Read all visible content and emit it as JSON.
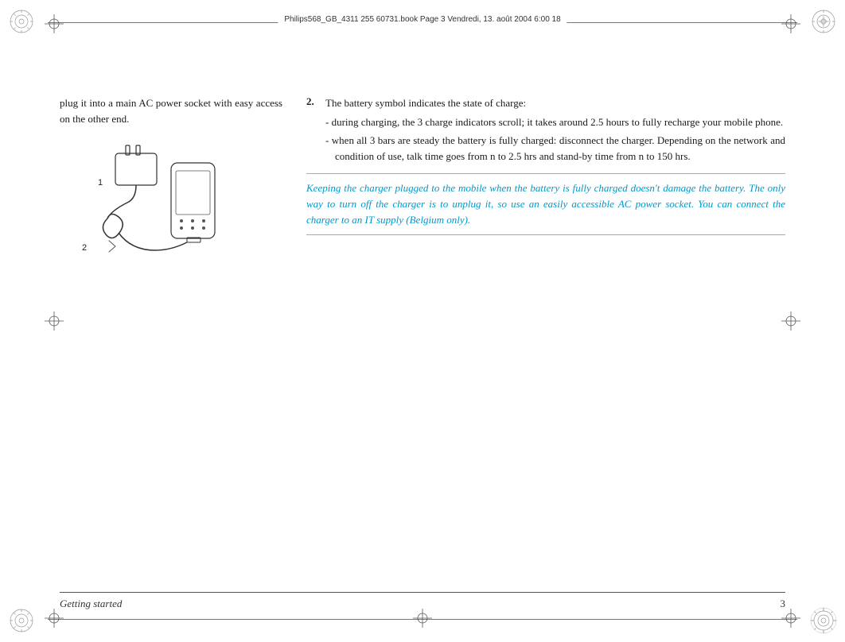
{
  "header": {
    "text": "Philips568_GB_4311 255 60731.book  Page 3  Vendredi, 13. août 2004  6:00 18"
  },
  "left_column": {
    "paragraph": "plug it into a main AC power socket with easy access on the other end."
  },
  "right_column": {
    "point_number": "2.",
    "point_intro": "The battery symbol indicates the state of charge:",
    "bullets": [
      "during charging, the 3 charge indicators scroll; it takes around 2.5 hours to fully recharge your mobile phone.",
      "when all 3 bars are steady the battery is fully charged: disconnect the charger. Depending on the network and condition of use, talk time goes from n to 2.5 hrs and stand-by time from n to 150 hrs."
    ]
  },
  "note": {
    "text": "Keeping the charger plugged to the mobile when the battery is fully charged doesn't damage the battery. The only way to turn off the charger is to unplug it, so use an easily accessible AC power socket. You can connect the charger to an IT supply (Belgium only)."
  },
  "footer": {
    "left": "Getting started",
    "right": "3"
  },
  "labels": {
    "step1": "1",
    "step2": "2"
  }
}
